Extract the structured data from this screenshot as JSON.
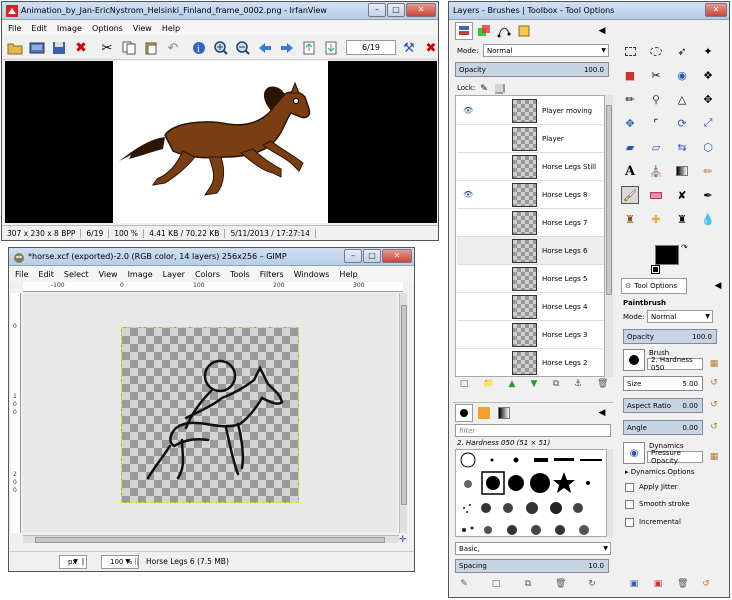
{
  "irfanview": {
    "title": "Animation_by_Jan-EricNystrom_Helsinki_Finland_frame_0002.png - IrfanView",
    "menu": [
      "File",
      "Edit",
      "Image",
      "Options",
      "View",
      "Help"
    ],
    "page_field": "6/19",
    "status": [
      "307 x 230 x 8 BPP",
      "6/19",
      "100 %",
      "4.41 KB / 70.22 KB",
      "5/11/2013 / 17:27:14"
    ]
  },
  "gimp_image": {
    "title": "*horse.xcf (exported)-2.0 (RGB color, 14 layers) 256x256 – GIMP",
    "menu": [
      "File",
      "Edit",
      "Select",
      "View",
      "Image",
      "Layer",
      "Colors",
      "Tools",
      "Filters",
      "Windows",
      "Help"
    ],
    "ruler_labels": [
      "-100",
      "0",
      "100",
      "200",
      "300"
    ],
    "vruler_labels": [
      "0",
      "1",
      "0",
      "0",
      "2",
      "0",
      "0"
    ],
    "unit": "px",
    "zoom": "100 %",
    "status_text": "Horse Legs 6 (7.5 MB)"
  },
  "dock": {
    "title": "Layers - Brushes | Toolbox - Tool Options",
    "mode_label": "Mode:",
    "mode_value": "Normal",
    "opacity_label": "Opacity",
    "opacity_value": "100.0",
    "lock_label": "Lock:",
    "layers": [
      {
        "name": "Player moving",
        "visible": true
      },
      {
        "name": "Player",
        "visible": false
      },
      {
        "name": "Horse Legs Still",
        "visible": false
      },
      {
        "name": "Horse Legs 8",
        "visible": true
      },
      {
        "name": "Horse Legs 7",
        "visible": false
      },
      {
        "name": "Horse Legs 6",
        "visible": false
      },
      {
        "name": "Horse Legs 5",
        "visible": false
      },
      {
        "name": "Horse Legs 4",
        "visible": false
      },
      {
        "name": "Horse Legs 3",
        "visible": false
      },
      {
        "name": "Horse Legs 2",
        "visible": false
      }
    ],
    "filter_placeholder": "filter",
    "brush_name": "2. Hardness 050 (51 × 51)",
    "brush_tag": "Basic,",
    "spacing_label": "Spacing",
    "spacing_value": "10.0"
  },
  "tool_options": {
    "tab_label": "Tool Options",
    "tool_name": "Paintbrush",
    "mode_label": "Mode:",
    "mode_value": "Normal",
    "opacity_label": "Opacity",
    "opacity_value": "100.0",
    "brush_label": "Brush",
    "brush_value": "2. Hardness 050",
    "size_label": "Size",
    "size_value": "5.00",
    "aspect_label": "Aspect Ratio",
    "aspect_value": "0.00",
    "angle_label": "Angle",
    "angle_value": "0.00",
    "dynamics_label": "Dynamics",
    "dynamics_value": "Pressure Opacity",
    "dynamics_options": "Dynamics Options",
    "apply_jitter": "Apply Jitter",
    "smooth_stroke": "Smooth stroke",
    "incremental": "Incremental"
  },
  "colors": {
    "accent": "#c7d4e4",
    "title_bar": "#cfe0f3",
    "horse": "#7a3e12",
    "fg": "#000000",
    "bg": "#ffffff"
  }
}
